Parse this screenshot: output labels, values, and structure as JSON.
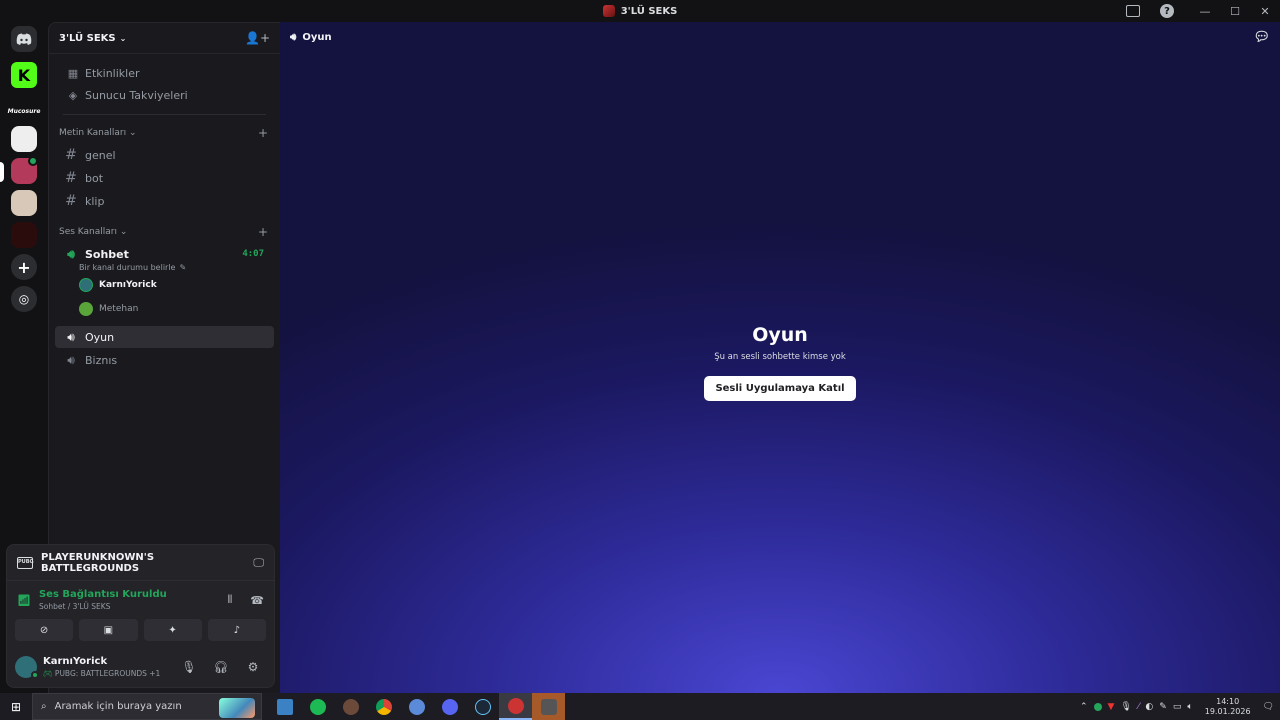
{
  "window": {
    "title": "3'LÜ SEKS"
  },
  "guild": {
    "name": "3'LÜ SEKS"
  },
  "nav": [
    {
      "label": "Etkinlikler",
      "icon": "calendar-icon"
    },
    {
      "label": "Sunucu Takviyeleri",
      "icon": "boost-icon"
    }
  ],
  "categories": {
    "text": "Metin Kanalları",
    "voice": "Ses Kanalları"
  },
  "text_channels": [
    "genel",
    "bot",
    "klip"
  ],
  "voice_channels": {
    "sohbet": {
      "name": "Sohbet",
      "timer": "4:07",
      "status_hint": "Bir kanal durumu belirle",
      "users": [
        "KarnıYorick",
        "Metehan"
      ]
    },
    "oyun": {
      "name": "Oyun"
    },
    "biznis": {
      "name": "Biznıs"
    }
  },
  "servers": {
    "text_label": "Mucosure"
  },
  "panel": {
    "game": "PLAYERUNKNOWN'S BATTLEGROUNDS",
    "connection_title": "Ses Bağlantısı Kuruldu",
    "connection_sub": "Sohbet / 3'LÜ SEKS",
    "user_name": "KarnıYorick",
    "user_activity": "PUBG: BATTLEGROUNDS +1"
  },
  "main": {
    "header": "Oyun",
    "title": "Oyun",
    "subtitle": "Şu an sesli sohbette kimse yok",
    "join_label": "Sesli Uygulamaya Katıl"
  },
  "taskbar": {
    "search_placeholder": "Aramak için buraya yazın",
    "time": "14:10",
    "date": "19.01.2026",
    "notif_count": "1"
  },
  "colors": {
    "online": "#23a55a",
    "accent": "#4a46d2"
  }
}
